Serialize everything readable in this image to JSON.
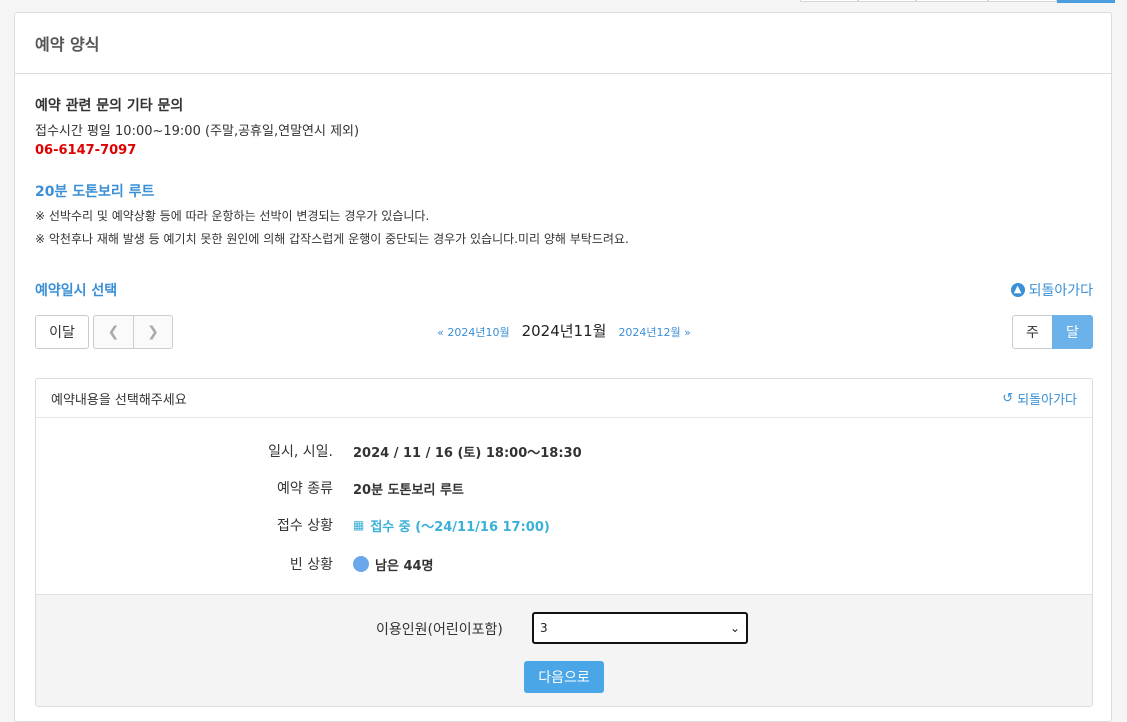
{
  "panel": {
    "title": "예약 양식"
  },
  "info": {
    "title": "예약 관련 문의 기타 문의",
    "hours": "접수시간 평일 10:00~19:00 (주말,공휴일,연말연시 제외)",
    "phone": "06-6147-7097"
  },
  "route": {
    "title": "20분 도톤보리 루트",
    "notice1": "※ 선박수리 및 예약상황 등에 따라 운항하는 선박이 변경되는 경우가 있습니다.",
    "notice2": "※ 악천후나 재해 발생 등 예기치 못한 원인에 의해 갑작스럽게 운행이 중단되는 경우가 있습니다.미리 양해 부탁드려요."
  },
  "calendar": {
    "section_title": "예약일시 선택",
    "back_label": "되돌아가다",
    "this_month": "이달",
    "prev_month": "2024년10월",
    "current_month": "2024년11월",
    "next_month": "2024년12월",
    "view_week": "주",
    "view_month": "달"
  },
  "detail": {
    "heading": "예약내용을 선택해주세요",
    "back_label": "되돌아가다",
    "rows": [
      {
        "label": "일시, 시일.",
        "value": "2024 / 11 / 16 (토) 18:00～18:30"
      },
      {
        "label": "예약 종류",
        "value": "20분 도톤보리 루트"
      },
      {
        "label": "접수 상황",
        "value": "접수 중 (～24/11/16 17:00)"
      },
      {
        "label": "빈 상황",
        "value": "남은 44명"
      }
    ],
    "people_label": "이용인원(어린이포함)",
    "people_value": "3",
    "next_button": "다음으로"
  },
  "colors": {
    "accent": "#3a8fd6",
    "phone": "#e00000",
    "status": "#3ab0d8",
    "button": "#4aa6e6"
  }
}
